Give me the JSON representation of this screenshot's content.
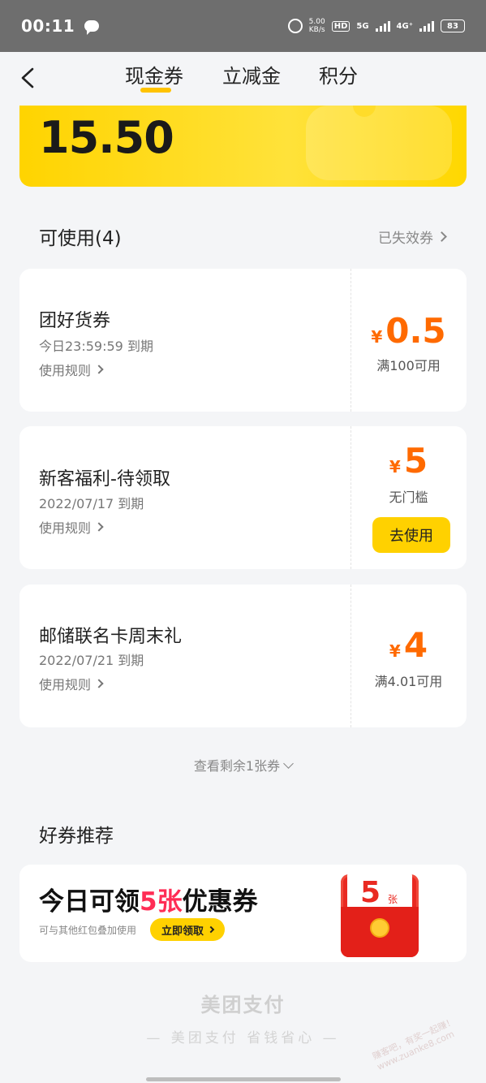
{
  "status_bar": {
    "time": "00:11",
    "net_speed_value": "5.00",
    "net_speed_unit": "KB/s",
    "hd_label": "HD",
    "sim1_label": "5G",
    "sim2_label": "4G⁺",
    "battery": "83"
  },
  "header": {
    "tabs": [
      {
        "label": "现金券",
        "active": true
      },
      {
        "label": "立减金",
        "active": false
      },
      {
        "label": "积分",
        "active": false
      }
    ]
  },
  "balance": {
    "amount": "15.50"
  },
  "available": {
    "title": "可使用(4)",
    "expired_link": "已失效券"
  },
  "coupons": [
    {
      "name": "团好货券",
      "expiry": "今日23:59:59 到期",
      "rules": "使用规则",
      "currency": "¥",
      "amount": "0.5",
      "condition": "满100可用"
    },
    {
      "name": "新客福利-待领取",
      "expiry": "2022/07/17 到期",
      "rules": "使用规则",
      "currency": "¥",
      "amount": "5",
      "condition": "无门槛",
      "button": "去使用"
    },
    {
      "name": "邮储联名卡周末礼",
      "expiry": "2022/07/21 到期",
      "rules": "使用规则",
      "currency": "¥",
      "amount": "4",
      "condition": "满4.01可用"
    }
  ],
  "more_link": "查看剩余1张券",
  "recommend": {
    "title": "好券推荐",
    "headline_pre": "今日可领",
    "headline_hl": "5张",
    "headline_post": "优惠券",
    "sub": "可与其他红包叠加使用",
    "claim_button": "立即领取",
    "packet_num": "5",
    "packet_unit": "张"
  },
  "footer": {
    "brand": "美团支付",
    "slogan": "—  美团支付  省钱省心  —"
  },
  "watermark": "赚客吧，有奖一起赚！ www.zuanke8.com",
  "colors": {
    "accent_yellow": "#ffd100",
    "price_orange": "#ff6a00",
    "highlight_red": "#ff2d55"
  }
}
